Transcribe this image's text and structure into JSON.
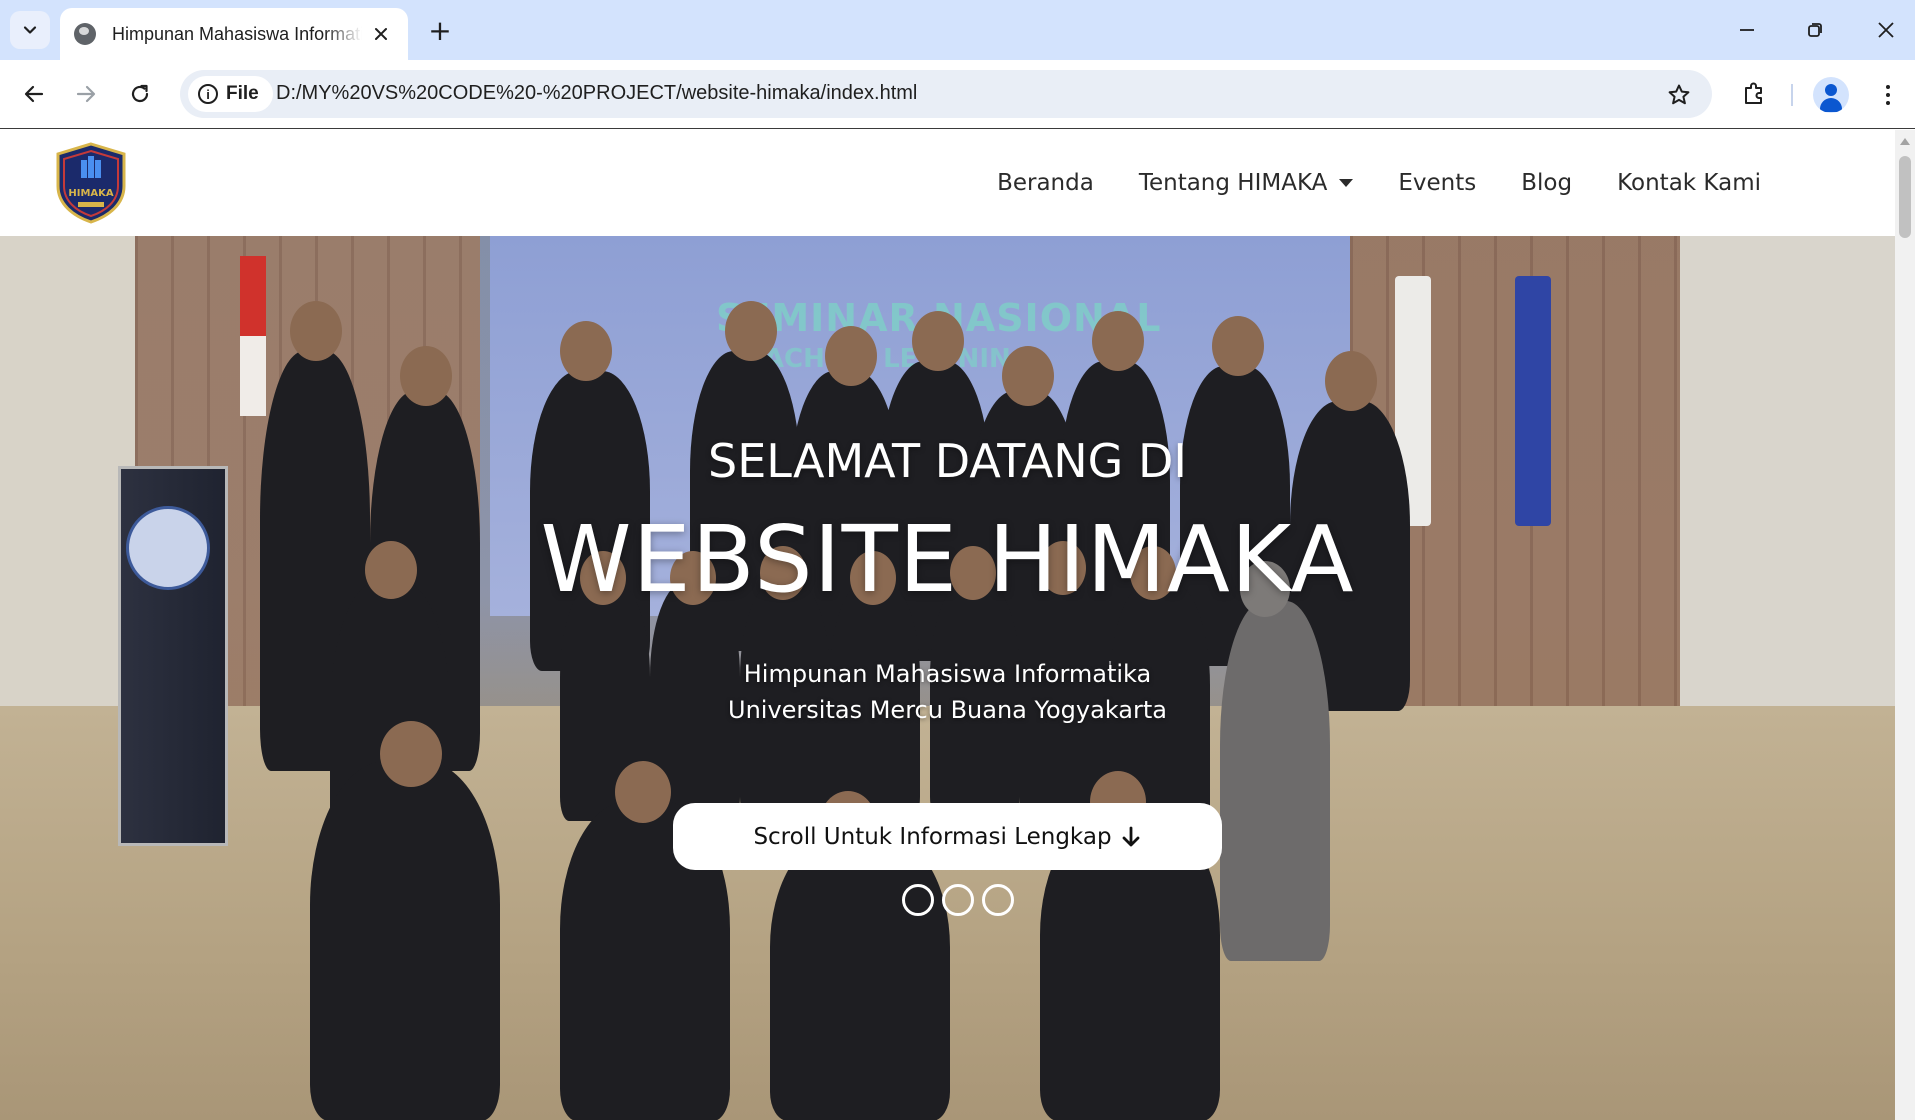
{
  "browser": {
    "tab_title": "Himpunan Mahasiswa Informatika",
    "new_tab_icon": "+",
    "site_info_label": "File",
    "url": "D:/MY%20VS%20CODE%20-%20PROJECT/website-himaka/index.html",
    "icons": [
      "tab-search-icon",
      "globe-favicon-icon",
      "close-icon",
      "new-tab-icon",
      "minimize-icon",
      "restore-icon",
      "window-close-icon",
      "back-icon",
      "forward-icon",
      "reload-icon",
      "info-icon",
      "bookmark-star-icon",
      "extensions-icon",
      "profile-icon",
      "menu-icon"
    ]
  },
  "site": {
    "logo_text": "HIMAKA",
    "nav": {
      "items": [
        {
          "label": "Beranda"
        },
        {
          "label": "Tentang HIMAKA",
          "has_dropdown": true
        },
        {
          "label": "Events"
        },
        {
          "label": "Blog"
        },
        {
          "label": "Kontak Kami"
        }
      ]
    },
    "hero": {
      "background_text_1": "SEMINAR NASIONAL",
      "background_text_2": "MACHINE LEARNING",
      "kicker": "SELAMAT DATANG DI",
      "title": "WEBSITE HIMAKA",
      "subtitle_line1": "Himpunan Mahasiswa Informatika",
      "subtitle_line2": "Universitas Mercu Buana Yogyakarta",
      "cta_label": "Scroll Untuk Informasi Lengkap",
      "cta_icon": "arrow-down-icon",
      "carousel_dots": 3
    }
  },
  "colors": {
    "tabstrip": "#d3e3fd",
    "omnibox": "#e9eef6",
    "profile_accent": "#0b57d0",
    "logo_navy": "#1b2a6b",
    "logo_gold": "#d8b54a"
  }
}
